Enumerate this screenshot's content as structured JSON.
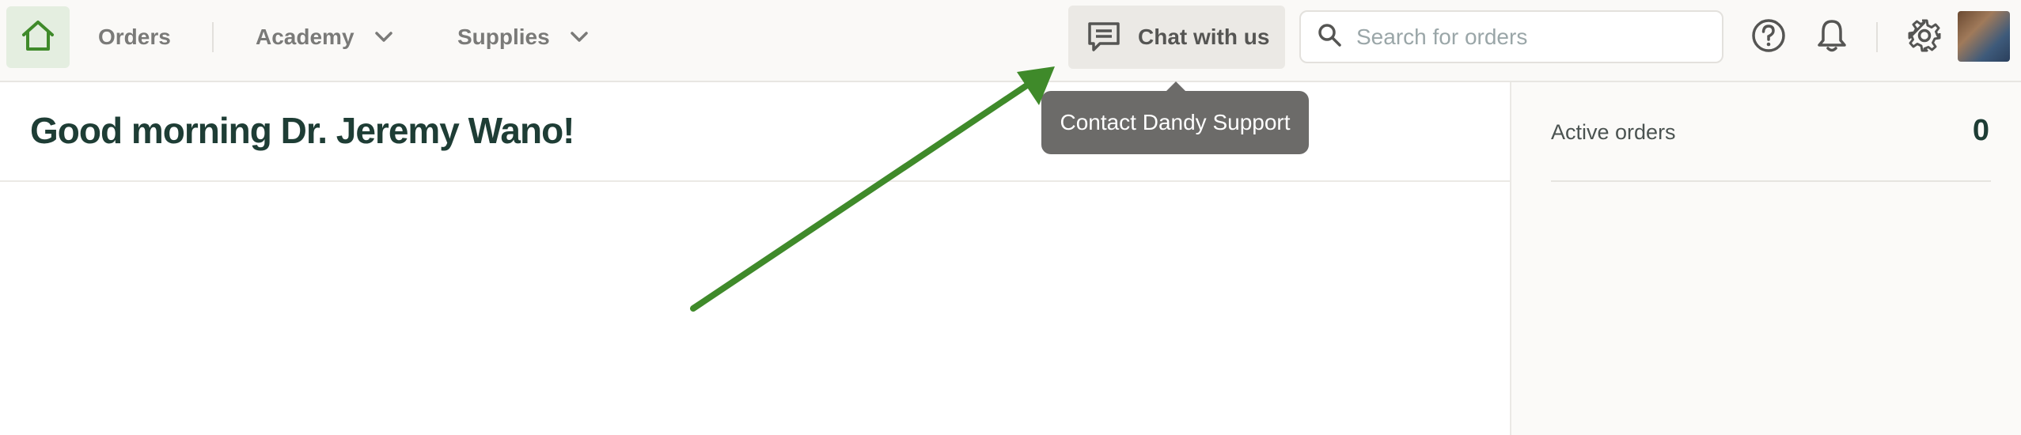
{
  "nav": {
    "home_icon": "home-icon",
    "orders_label": "Orders",
    "academy_label": "Academy",
    "supplies_label": "Supplies"
  },
  "chat": {
    "label": "Chat with us",
    "icon": "chat-bubble-icon",
    "tooltip": "Contact Dandy Support"
  },
  "search": {
    "placeholder": "Search for orders",
    "value": ""
  },
  "main": {
    "greeting": "Good morning Dr. Jeremy Wano!"
  },
  "sidebar": {
    "active_orders_label": "Active orders",
    "active_orders_count": "0"
  },
  "colors": {
    "brand_green": "#3f8a2a",
    "annotation_arrow": "#3f8a2a",
    "heading": "#1e3d35"
  }
}
